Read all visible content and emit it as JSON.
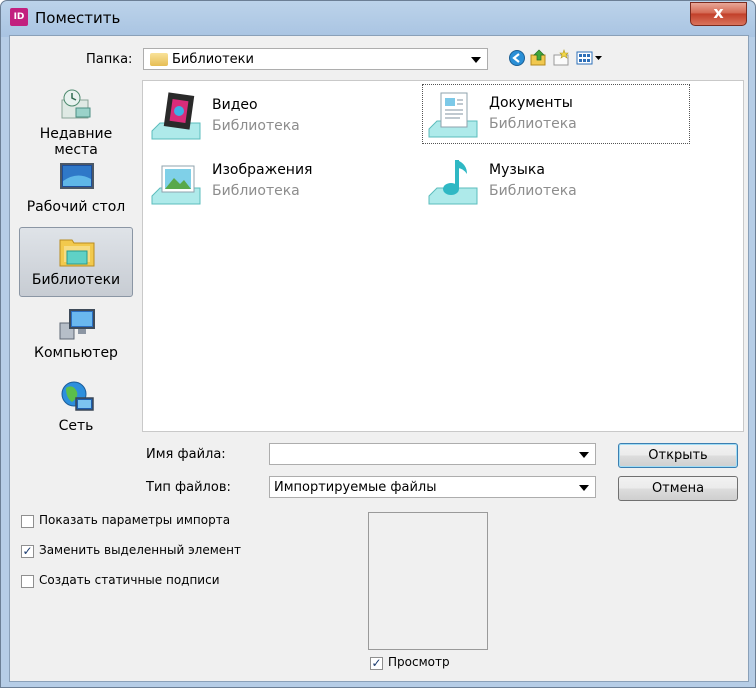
{
  "window": {
    "title": "Поместить",
    "app_icon_text": "ID",
    "close_label": "x"
  },
  "toolbar": {
    "folder_label": "Папка:",
    "folder_value": "Библиотеки"
  },
  "places": [
    {
      "label": "Недавние места",
      "icon": "recent-places-icon"
    },
    {
      "label": "Рабочий стол",
      "icon": "desktop-icon"
    },
    {
      "label": "Библиотеки",
      "icon": "libraries-icon",
      "selected": true
    },
    {
      "label": "Компьютер",
      "icon": "computer-icon"
    },
    {
      "label": "Сеть",
      "icon": "network-icon"
    }
  ],
  "files": [
    {
      "name": "Видео",
      "type": "Библиотека",
      "icon": "video-library-icon"
    },
    {
      "name": "Документы",
      "type": "Библиотека",
      "icon": "documents-library-icon",
      "focused": true
    },
    {
      "name": "Изображения",
      "type": "Библиотека",
      "icon": "pictures-library-icon"
    },
    {
      "name": "Музыка",
      "type": "Библиотека",
      "icon": "music-library-icon"
    }
  ],
  "form": {
    "filename_label": "Имя файла:",
    "filename_value": "",
    "filetype_label": "Тип файлов:",
    "filetype_value": "Импортируемые файлы"
  },
  "buttons": {
    "open": "Открыть",
    "cancel": "Отмена"
  },
  "options": [
    {
      "label": "Показать параметры импорта",
      "checked": false
    },
    {
      "label": "Заменить выделенный элемент",
      "checked": true
    },
    {
      "label": "Создать статичные подписи",
      "checked": false
    }
  ],
  "preview": {
    "label": "Просмотр",
    "checked": true
  },
  "colors": {
    "titlebar": "#a9c4e2",
    "close_button": "#c2402a",
    "selection": "#c7ccd3"
  }
}
